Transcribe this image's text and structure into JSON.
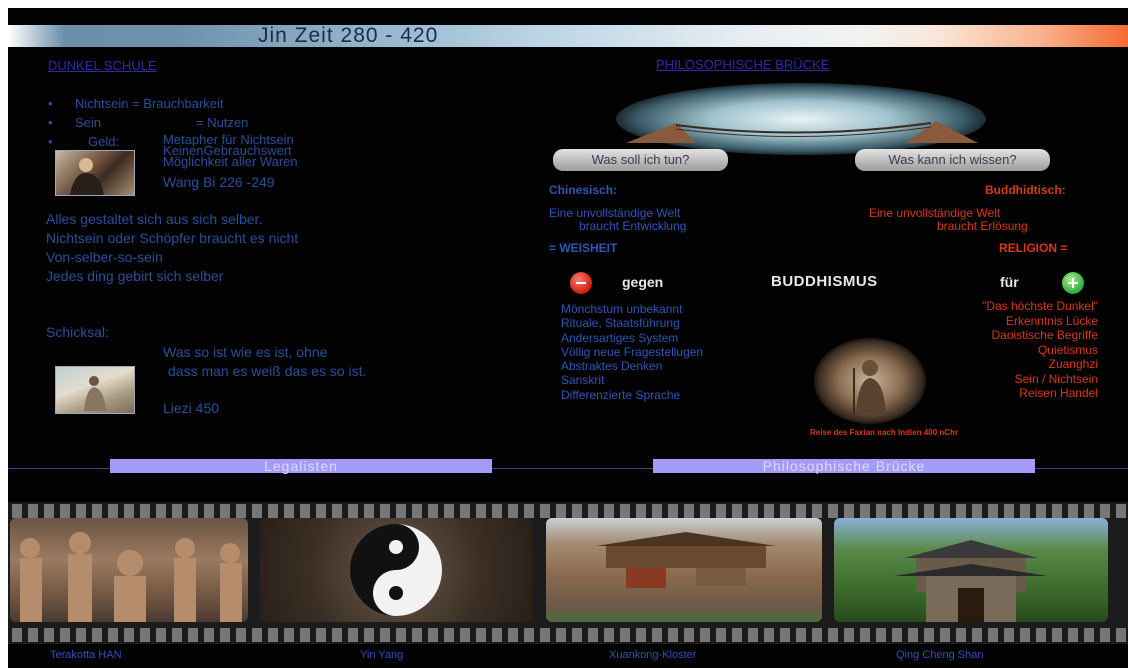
{
  "title": "Jin Zeit 280 - 420",
  "left": {
    "heading": "DUNKEL SCHULE",
    "bullets": [
      {
        "a": "Nichtsein = Brauchbarkeit",
        "b": ""
      },
      {
        "a": "Sein",
        "b": "= Nutzen"
      },
      {
        "a": "Geld:",
        "b": ""
      }
    ],
    "geld_lines": [
      "Metapher für Nichtsein",
      "KeinenGebrauchswert",
      "Möglichkeit aller Waren"
    ],
    "wang": "Wang Bi 226 -249",
    "statements": [
      "Alles gestaltet sich aus sich selber.",
      "Nichtsein oder Schöpfer braucht es nicht",
      "Von-selber-so-sein",
      "Jedes ding gebirt sich selber"
    ],
    "schicksal": "Schicksal:",
    "quote1": "Was so ist wie es ist, ohne",
    "quote2": "dass man es weiß das es so ist.",
    "liezi": "Liezi 450"
  },
  "right": {
    "heading_a": "PHILOSOPHISCHE",
    "heading_b": "BRÜCKE",
    "bubble_left": "Was soll ich tun?",
    "bubble_right": "Was kann ich wissen?",
    "chin_head": "Chinesisch:",
    "budd_head": "Buddhidtisch:",
    "chin_l1": "Eine unvollständige  Welt",
    "chin_l2": "braucht Entwicklung",
    "budd_l1": "Eine unvollständige  Welt",
    "budd_l2": "braucht Erlösung",
    "weisheit": "= WEISHEIT",
    "religion": "RELIGION =",
    "gegen": "gegen",
    "buddhismus": "BUDDHISMUS",
    "fur": "für",
    "gegen_list": [
      "Mönchstum unbekannt",
      "Rituale, Staatsführung",
      "Andersartiges System",
      "Völlig neue Fragestellugen",
      "Abstraktes Denken",
      "Sanskrit",
      "Differenzierte Sprache"
    ],
    "fur_list": [
      "\"Das höchste Dunkel\"",
      "Erkenntnis Lücke",
      "Daoistische Begriffe",
      "Quietismus",
      "Zuanghzi",
      "Sein / Nichtsein",
      "Reisen Handel"
    ],
    "faxian": "Reise des Faxian nach Indien 400 nChr"
  },
  "nav": {
    "left": "Legalisten",
    "right": "Philosophische Brücke"
  },
  "captions": [
    "Terakotta HAN",
    "Yin Yang",
    "Xuankong-Kloster",
    "Qing Cheng Shan"
  ],
  "colors": {
    "accent_orange": "#d63a11",
    "text_blue": "#2a4f97",
    "nav_bar": "#a39bf6"
  }
}
